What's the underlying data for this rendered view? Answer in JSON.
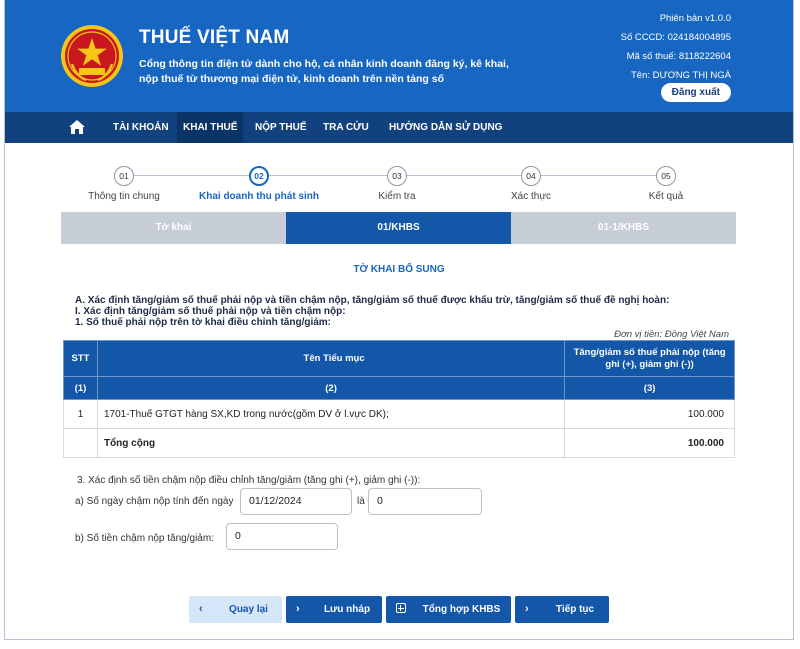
{
  "header": {
    "title": "THUẾ VIỆT NAM",
    "description": "Cổng thông tin điện tử dành cho hộ, cá nhân kinh doanh đăng ký, kê khai, nộp thuế từ thương mại điện tử, kinh doanh trên nền tảng số",
    "version": "Phiên bản v1.0.0",
    "cccd": "Số CCCD: 024184004895",
    "tax_code": "Mã số thuế: 8118222604",
    "name": "Tên: DƯƠNG THỊ NGÀ",
    "logout_label": "Đăng xuất",
    "colors": {
      "primary": "#1766c2",
      "nav": "#11427d",
      "emblem_red": "#c8171e",
      "emblem_gold": "#f5c518"
    }
  },
  "nav": {
    "home_icon": "home-icon",
    "items": [
      {
        "label": "TÀI KHOẢN"
      },
      {
        "label": "KHAI THUẾ"
      },
      {
        "label": "NỘP THUẾ"
      },
      {
        "label": "TRA CỨU"
      },
      {
        "label": "HƯỚNG DẪN SỬ DỤNG"
      }
    ],
    "active": "KHAI THUẾ"
  },
  "steps": [
    {
      "num": "01",
      "label": "Thông tin chung"
    },
    {
      "num": "02",
      "label": "Khai doanh thu phát sinh"
    },
    {
      "num": "03",
      "label": "Kiểm tra"
    },
    {
      "num": "04",
      "label": "Xác thực"
    },
    {
      "num": "05",
      "label": "Kết quả"
    }
  ],
  "active_step": "02",
  "tabs": [
    {
      "label": "Tờ khai"
    },
    {
      "label": "01/KHBS"
    },
    {
      "label": "01-1/KHBS"
    }
  ],
  "active_tab": "01/KHBS",
  "form": {
    "title": "TỜ KHAI BỔ SUNG",
    "section_a": "A. Xác định tăng/giảm số thuế phải nộp và tiền chậm nộp, tăng/giảm số thuế được khấu trừ, tăng/giảm số thuế đề nghị hoàn:",
    "section_i": "I. Xác định tăng/giảm số thuế phải nộp và tiền chậm nộp:",
    "section_1": "1. Số thuế phải nộp trên tờ khai điều chỉnh tăng/giảm:",
    "unit": "Đơn vị tiền: Đồng Việt Nam"
  },
  "table": {
    "headers": [
      "STT",
      "Tên Tiểu mục",
      "Tăng/giảm số thuế phải nộp (tăng ghi (+), giảm ghi (-))"
    ],
    "subheaders": [
      "(1)",
      "(2)",
      "(3)"
    ],
    "rows": [
      {
        "stt": "1",
        "name": "1701-Thuế GTGT hàng SX,KD trong nước(gồm DV ở l.vực DK);",
        "value": "100.000"
      }
    ],
    "total_label": "Tổng cộng",
    "total_value": "100.000"
  },
  "late_payment": {
    "heading": "3. Xác định số tiền chậm nộp điều chỉnh tăng/giảm (tăng ghi (+), giảm ghi (-)):",
    "days_label": "a) Số ngày chậm nộp tính đến ngày",
    "date_value": "01/12/2024",
    "la_label": "là",
    "days_value": "0",
    "amount_label": "b) Số tiền chậm nộp tăng/giảm:",
    "amount_value": "0"
  },
  "buttons": {
    "back": "Quay lại",
    "draft": "Lưu nháp",
    "summary": "Tổng hợp KHBS",
    "next": "Tiếp tục"
  }
}
